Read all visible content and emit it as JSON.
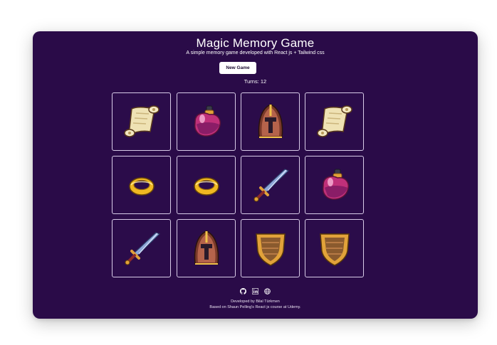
{
  "header": {
    "title": "Magic Memory Game",
    "subtitle": "A simple memory game developed with React js + Tailwind css"
  },
  "controls": {
    "new_game_label": "New Game",
    "turns_text": "Turns: 12"
  },
  "cards": [
    {
      "icon": "scroll"
    },
    {
      "icon": "potion"
    },
    {
      "icon": "helmet"
    },
    {
      "icon": "scroll"
    },
    {
      "icon": "ring"
    },
    {
      "icon": "ring"
    },
    {
      "icon": "sword"
    },
    {
      "icon": "potion"
    },
    {
      "icon": "sword"
    },
    {
      "icon": "helmet"
    },
    {
      "icon": "shield"
    },
    {
      "icon": "shield"
    }
  ],
  "footer": {
    "icons": [
      "github-icon",
      "linkedin-icon",
      "globe-icon"
    ],
    "credit": "Developed by Bilal Türkmen",
    "based_on": "Based on Shaun Pelling's React js course at Udemy."
  },
  "colors": {
    "background": "#2a0b48",
    "card_border": "#d8cce8",
    "text": "#ffffff"
  }
}
